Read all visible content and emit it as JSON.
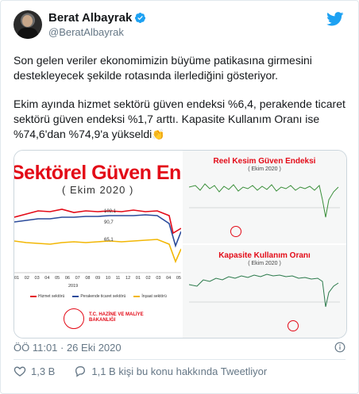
{
  "tweet": {
    "author_name": "Berat Albayrak",
    "author_handle": "@BeratAlbayrak",
    "paragraph_1": "Son gelen veriler ekonomimizin büyüme patikasına girmesini destekleyecek şekilde rotasında ilerlediğini gösteriyor.",
    "paragraph_2": "Ekim ayında hizmet sektörü güven endeksi %6,4, perakende ticaret sektörü güven endeksi %1,7 arttı. Kapasite Kullanım Oranı ise %74,6'dan %74,9'a yükseldi",
    "emoji": "👏",
    "timestamp": "ÖÖ 11:01 · 26 Eki 2020",
    "likes": "1,3 B",
    "discussion": "1,1 B kişi bu konu hakkında Tweetliyor"
  },
  "media": {
    "left": {
      "title": "Sektörel Güven Endeksi",
      "subtitle": "( Ekim 2020 )",
      "values": [
        "102,1",
        "90,7",
        "65,1"
      ],
      "months": [
        "01",
        "02",
        "03",
        "04",
        "05",
        "06",
        "07",
        "08",
        "09",
        "10",
        "11",
        "12",
        "01",
        "02",
        "03",
        "04",
        "05"
      ],
      "year": "2019",
      "legend": [
        "Hizmet sektörü",
        "Perakende ticaret sektörü",
        "İnşaat sektörü"
      ],
      "ministry": "T.C. HAZİNE VE MALİYE BAKANLIĞI"
    },
    "right_top": {
      "title": "Reel Kesim Güven Endeksi",
      "subtitle": "( Ekim 2020 )"
    },
    "right_bottom": {
      "title": "Kapasite Kullanım Oranı",
      "subtitle": "( Ekim 2020 )"
    },
    "colors": {
      "hizmet": "#e30a17",
      "perakende": "#2b4b9b",
      "insaat": "#f2b705",
      "reel": "#3a8f3a",
      "kko": "#2b7a4b"
    }
  },
  "icons": [
    "twitter-bird-icon",
    "verified-badge-icon",
    "info-icon",
    "heart-icon",
    "reply-bubble-icon"
  ]
}
